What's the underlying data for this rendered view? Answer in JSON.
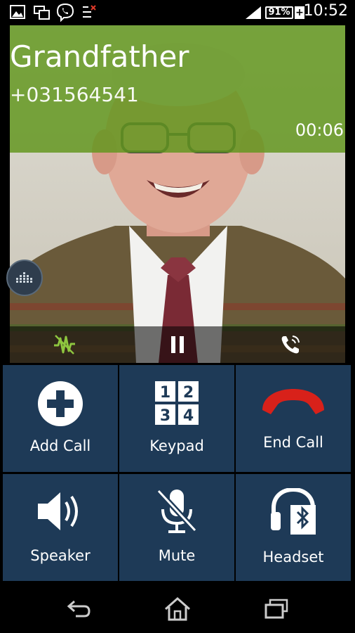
{
  "status_bar": {
    "battery": "91%",
    "time": "10:52",
    "icons": [
      "image-icon",
      "screen-mirror-icon",
      "viber-icon",
      "network-activity-icon",
      "signal-icon",
      "battery-icon",
      "charging-icon"
    ]
  },
  "call": {
    "name": "Grandfather",
    "number": "+031564541",
    "duration": "00:06",
    "accent": "#62961e"
  },
  "controls": {
    "icons": [
      "noise-reduction-icon",
      "pause-icon",
      "call-forward-icon"
    ]
  },
  "actions": [
    {
      "label": "Add Call",
      "icon": "add-call-icon"
    },
    {
      "label": "Keypad",
      "icon": "keypad-icon",
      "keys": [
        "1",
        "2",
        "3",
        "4"
      ]
    },
    {
      "label": "End Call",
      "icon": "end-call-icon"
    },
    {
      "label": "Speaker",
      "icon": "speaker-icon"
    },
    {
      "label": "Mute",
      "icon": "mute-icon"
    },
    {
      "label": "Headset",
      "icon": "bluetooth-headset-icon"
    }
  ],
  "colors": {
    "tile": "#1e3a57",
    "end_call": "#d8211a"
  },
  "nav": {
    "icons": [
      "back-icon",
      "home-icon",
      "recent-apps-icon"
    ]
  }
}
